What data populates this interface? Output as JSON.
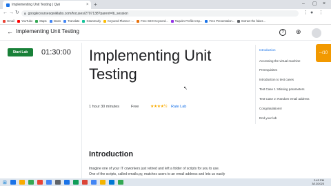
{
  "browser": {
    "tab_title": "Implementing Unit Testing | Qwi",
    "tab_close": "×",
    "new_tab": "+",
    "url": "googlecoursesqwiklabs.com/focuses/2707138?parent=lti_session",
    "window_controls": [
      "–",
      "▢",
      "×"
    ],
    "bookmarks": [
      {
        "label": "Gmail",
        "color": "#ea4335"
      },
      {
        "label": "YouTube",
        "color": "#ff0000"
      },
      {
        "label": "Maps",
        "color": "#34a853"
      },
      {
        "label": "News",
        "color": "#4285f4"
      },
      {
        "label": "Translate",
        "color": "#4285f4"
      },
      {
        "label": "Grammarly",
        "color": "#15c39a"
      },
      {
        "label": "Keyword Planner -...",
        "color": "#fbbc04"
      },
      {
        "label": "Free SEO Keyword...",
        "color": "#e8710a"
      },
      {
        "label": "Taqwim Profile Insp...",
        "color": "#9334e6"
      },
      {
        "label": "Free Presentation...",
        "color": "#1a73e8"
      },
      {
        "label": "Extract the fakes...",
        "color": "#5f6368"
      }
    ]
  },
  "app": {
    "back_icon": "←",
    "title": "Implementing Unit Testing",
    "help_icon": "?",
    "globe_icon": "⊕"
  },
  "lab": {
    "start_label": "Start Lab",
    "timer": "01:30:00"
  },
  "main": {
    "title": "Implementing Unit Testing",
    "duration": "1 hour 30 minutes",
    "price": "Free",
    "stars": "★★★★½",
    "rate_label": "Rate Lab",
    "section_title": "Introduction",
    "paragraph_1": "Imagine one of your IT coworkers just retired and left a folder of scripts for you to use.",
    "paragraph_2": "One of the scripts, called emails.py, matches users to an email address and lets us easily"
  },
  "toc": {
    "items": [
      "Introduction",
      "Accessing the virtual machine",
      "Prerequisites",
      "Introduction to test cases",
      "Test Case 1: Missing parameters",
      "Test Case 2: Random email address",
      "Congratulations!",
      "End your lab"
    ],
    "score": "--/10"
  },
  "taskbar": {
    "time": "2:43 PM",
    "date": "3/12/2023",
    "apps": [
      "#1a73e8",
      "#f9ab00",
      "#34a853",
      "#ea4335",
      "#4285f4",
      "#5f6368",
      "#1a73e8",
      "#0f9d58",
      "#db4437",
      "#4285f4",
      "#f4b400",
      "#0078d4",
      "#34a853"
    ]
  }
}
